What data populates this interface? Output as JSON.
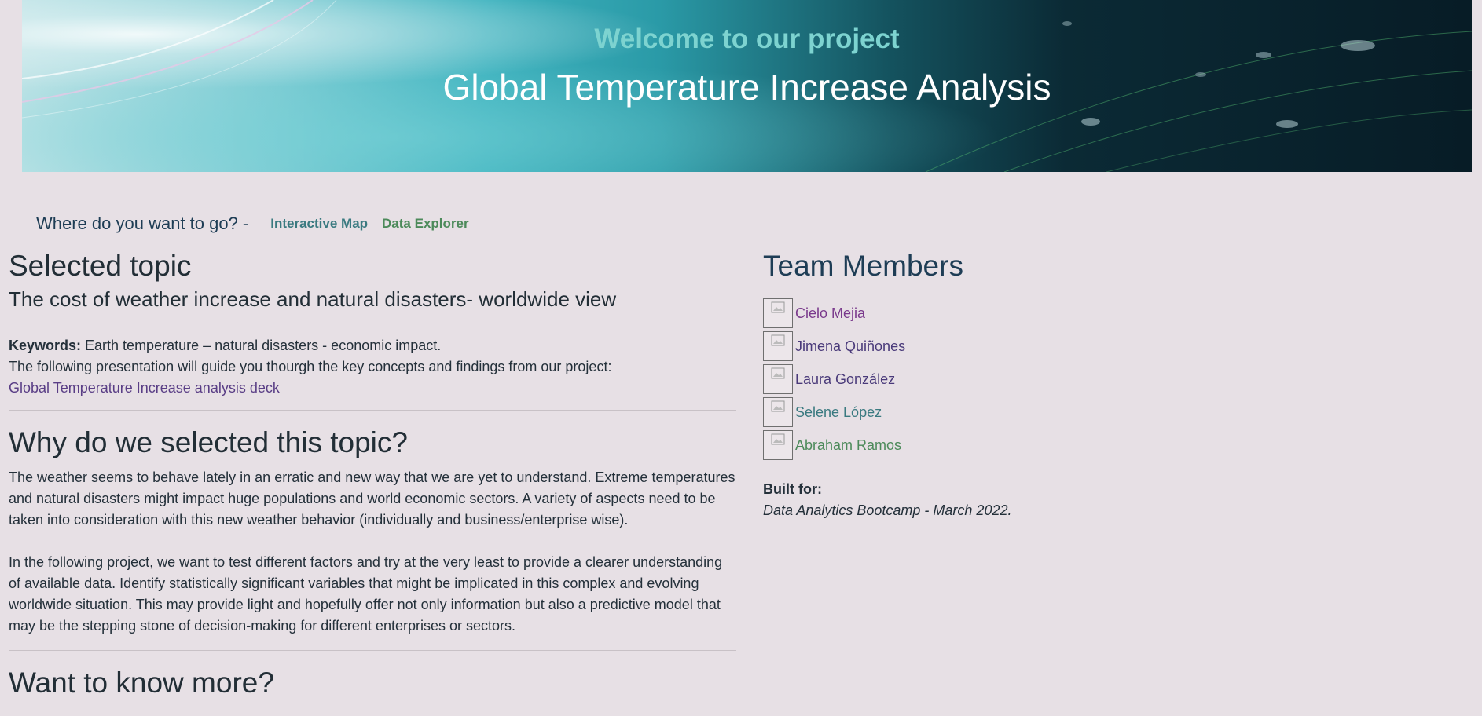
{
  "hero": {
    "subtitle": "Welcome to our project",
    "title": "Global Temperature Increase Analysis"
  },
  "nav": {
    "prompt": "Where do you want to go? -",
    "links": [
      {
        "label": "Interactive Map",
        "color": "#3a7a80"
      },
      {
        "label": "Data Explorer",
        "color": "#4c8a5a"
      }
    ]
  },
  "topic": {
    "heading": "Selected topic",
    "subtitle": "The cost of weather increase and natural disasters- worldwide view",
    "keywords_label": "Keywords:",
    "keywords": " Earth temperature – natural disasters - economic impact.",
    "guide_text": "The following presentation will guide you thourgh the key concepts and findings from our project:",
    "deck_link": "Global Temperature Increase analysis deck"
  },
  "why": {
    "heading": "Why do we selected this topic?",
    "p1": "The weather seems to behave lately in an erratic and new way that we are yet to understand. Extreme temperatures and natural disasters might impact huge populations and world economic sectors. A variety of aspects need to be taken into consideration with this new weather behavior (individually and business/enterprise wise).",
    "p2": "In the following project, we want to test different factors and try at the very least to provide a clearer understanding of available data. Identify statistically significant variables that might be implicated in this complex and evolving worldwide situation. This may provide light and hopefully offer not only information but also a predictive model that may be the stepping stone of decision-making for different enterprises or sectors."
  },
  "more": {
    "heading": "Want to know more?"
  },
  "team": {
    "heading": "Team Members",
    "members": [
      {
        "name": "Cielo Mejia",
        "color": "#7a3a8c"
      },
      {
        "name": "Jimena Quiñones",
        "color": "#4a3a7a"
      },
      {
        "name": "Laura González",
        "color": "#4a3a7a"
      },
      {
        "name": "Selene López",
        "color": "#3a7a80"
      },
      {
        "name": "Abraham Ramos",
        "color": "#4c8a5a"
      }
    ],
    "built_for_label": "Built for:",
    "built_for": "Data Analytics Bootcamp - March 2022."
  }
}
